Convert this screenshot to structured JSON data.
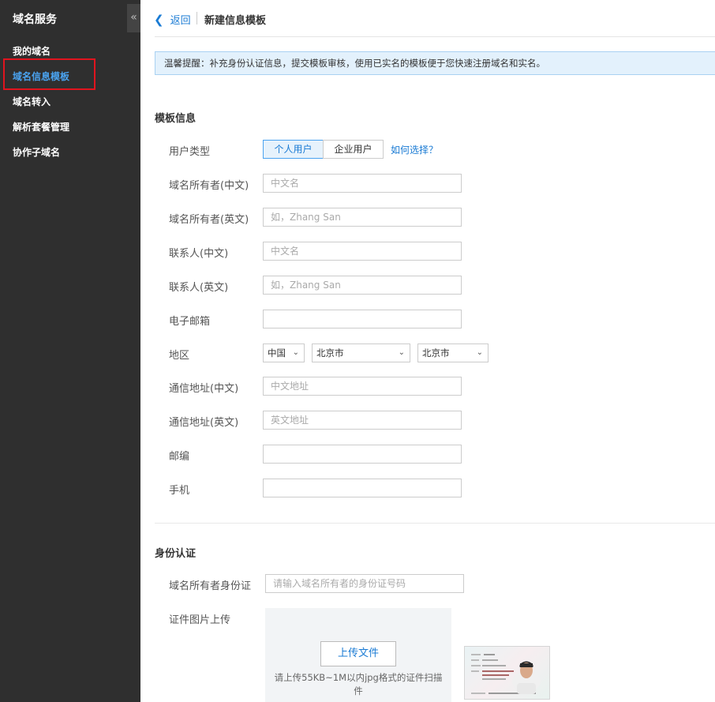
{
  "sidebar": {
    "title": "域名服务",
    "collapse_glyph": "«",
    "items": [
      {
        "label": "我的域名"
      },
      {
        "label": "域名信息模板"
      },
      {
        "label": "域名转入"
      },
      {
        "label": "解析套餐管理"
      },
      {
        "label": "协作子域名"
      }
    ],
    "active_index": 1
  },
  "header": {
    "back_label": "返回",
    "title": "新建信息模板"
  },
  "notice": "温馨提醒：补充身份认证信息，提交模板审核，使用已实名的模板便于您快速注册域名和实名。",
  "template_section": {
    "title": "模板信息",
    "user_type": {
      "label": "用户类型",
      "options": [
        "个人用户",
        "企业用户"
      ],
      "selected": "个人用户",
      "help": "如何选择？"
    },
    "fields": {
      "owner_cn": {
        "label": "域名所有者(中文)",
        "placeholder": "中文名",
        "value": ""
      },
      "owner_en": {
        "label": "域名所有者(英文)",
        "placeholder": "如，Zhang San",
        "value": ""
      },
      "contact_cn": {
        "label": "联系人(中文)",
        "placeholder": "中文名",
        "value": ""
      },
      "contact_en": {
        "label": "联系人(英文)",
        "placeholder": "如，Zhang San",
        "value": ""
      },
      "email": {
        "label": "电子邮箱",
        "placeholder": "",
        "value": ""
      },
      "address_cn": {
        "label": "通信地址(中文)",
        "placeholder": "中文地址",
        "value": ""
      },
      "address_en": {
        "label": "通信地址(英文)",
        "placeholder": "英文地址",
        "value": ""
      },
      "postcode": {
        "label": "邮编",
        "placeholder": "",
        "value": ""
      },
      "mobile": {
        "label": "手机",
        "placeholder": "",
        "value": ""
      }
    },
    "region": {
      "label": "地区",
      "country": "中国",
      "province": "北京市",
      "city": "北京市"
    }
  },
  "identity_section": {
    "title": "身份认证",
    "id_number": {
      "label": "域名所有者身份证",
      "placeholder": "请输入域名所有者的身份证号码",
      "value": ""
    },
    "upload": {
      "label": "证件图片上传",
      "button": "上传文件",
      "hint": "请上传55KB~1M以内jpg格式的证件扫描件"
    }
  },
  "colors": {
    "sidebar_bg": "#2f2f2f",
    "accent": "#1a7bd4",
    "highlight": "#e0141e"
  }
}
